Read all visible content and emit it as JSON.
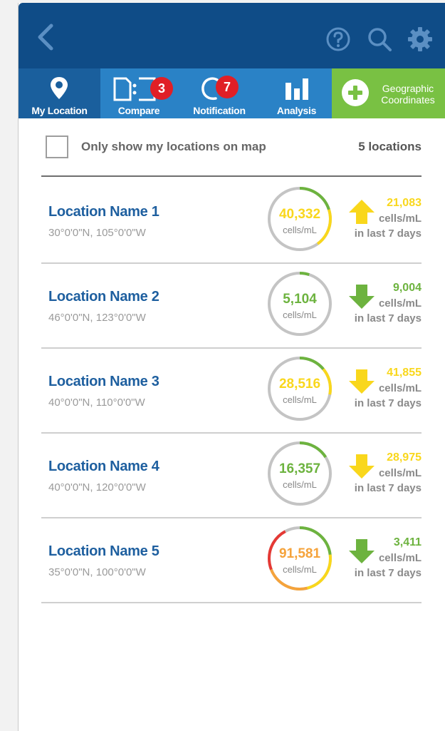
{
  "colors": {
    "header": "#0f4c87",
    "tab": "#2a82c6",
    "tab_active": "#1a5f9d",
    "geo": "#79c143",
    "badge": "#e01f26",
    "yellow": "#f9d71c",
    "green": "#6db33f",
    "orange": "#f5a33b",
    "red": "#e53935",
    "name": "#1e5f9f"
  },
  "header": {
    "icons": [
      "back-chevron-icon",
      "help-icon",
      "search-icon",
      "gear-icon"
    ]
  },
  "tabs": [
    {
      "label": "My Location",
      "icon": "map-pin-icon",
      "active": true
    },
    {
      "label": "Compare",
      "icon": "compare-icon",
      "badge": "3"
    },
    {
      "label": "Notification",
      "icon": "bell-icon",
      "badge": "7"
    },
    {
      "label": "Analysis",
      "icon": "bar-chart-icon"
    }
  ],
  "geo_button": {
    "line1": "Geographic",
    "line2": "Coordinates",
    "icon": "plus-circle-icon"
  },
  "filter": {
    "label": "Only show my locations on map",
    "count": "5 locations",
    "checked": false
  },
  "locations": [
    {
      "name": "Location Name 1",
      "coords": "30°0'0\"N, 105°0'0\"W",
      "value": "40,332",
      "unit": "cells/mL",
      "value_color": "#f9d71c",
      "ring_progress": 0.4,
      "ring_colors": [
        "#6db33f",
        "#f9d71c"
      ],
      "trend": "up",
      "trend_color": "#f9d71c",
      "change": "21,083",
      "change_unit": "cells/mL",
      "period": "in last 7 days"
    },
    {
      "name": "Location Name 2",
      "coords": "46°0'0\"N, 123°0'0\"W",
      "value": "5,104",
      "unit": "cells/mL",
      "value_color": "#6db33f",
      "ring_progress": 0.05,
      "ring_colors": [
        "#6db33f"
      ],
      "trend": "down",
      "trend_color": "#6db33f",
      "change": "9,004",
      "change_unit": "cells/mL",
      "period": "in last 7 days"
    },
    {
      "name": "Location Name 3",
      "coords": "40°0'0\"N, 110°0'0\"W",
      "value": "28,516",
      "unit": "cells/mL",
      "value_color": "#f9d71c",
      "ring_progress": 0.28,
      "ring_colors": [
        "#6db33f",
        "#f9d71c"
      ],
      "trend": "down",
      "trend_color": "#f9d71c",
      "change": "41,855",
      "change_unit": "cells/mL",
      "period": "in last 7 days"
    },
    {
      "name": "Location Name 4",
      "coords": "40°0'0\"N, 120°0'0\"W",
      "value": "16,357",
      "unit": "cells/mL",
      "value_color": "#6db33f",
      "ring_progress": 0.16,
      "ring_colors": [
        "#6db33f"
      ],
      "trend": "down",
      "trend_color": "#f9d71c",
      "change": "28,975",
      "change_unit": "cells/mL",
      "period": "in last 7 days"
    },
    {
      "name": "Location Name 5",
      "coords": "35°0'0\"N, 100°0'0\"W",
      "value": "91,581",
      "unit": "cells/mL",
      "value_color": "#f5a33b",
      "ring_progress": 0.92,
      "ring_colors": [
        "#6db33f",
        "#f9d71c",
        "#f5a33b",
        "#e53935"
      ],
      "trend": "down",
      "trend_color": "#6db33f",
      "change": "3,411",
      "change_unit": "cells/mL",
      "period": "in last 7 days"
    }
  ]
}
